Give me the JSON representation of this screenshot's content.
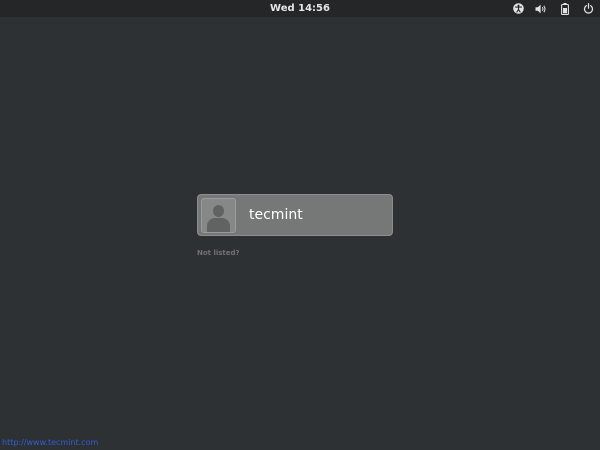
{
  "topbar": {
    "clock": "Wed 14:56",
    "icons": [
      "accessibility-icon",
      "volume-icon",
      "battery-icon",
      "power-icon"
    ]
  },
  "login": {
    "username": "tecmint",
    "not_listed": "Not listed?"
  },
  "watermark": "http://www.tecmint.com",
  "colors": {
    "background": "#2e3133",
    "topbar": "#242628",
    "user_card": "#767878",
    "watermark": "#2f5fd8"
  }
}
